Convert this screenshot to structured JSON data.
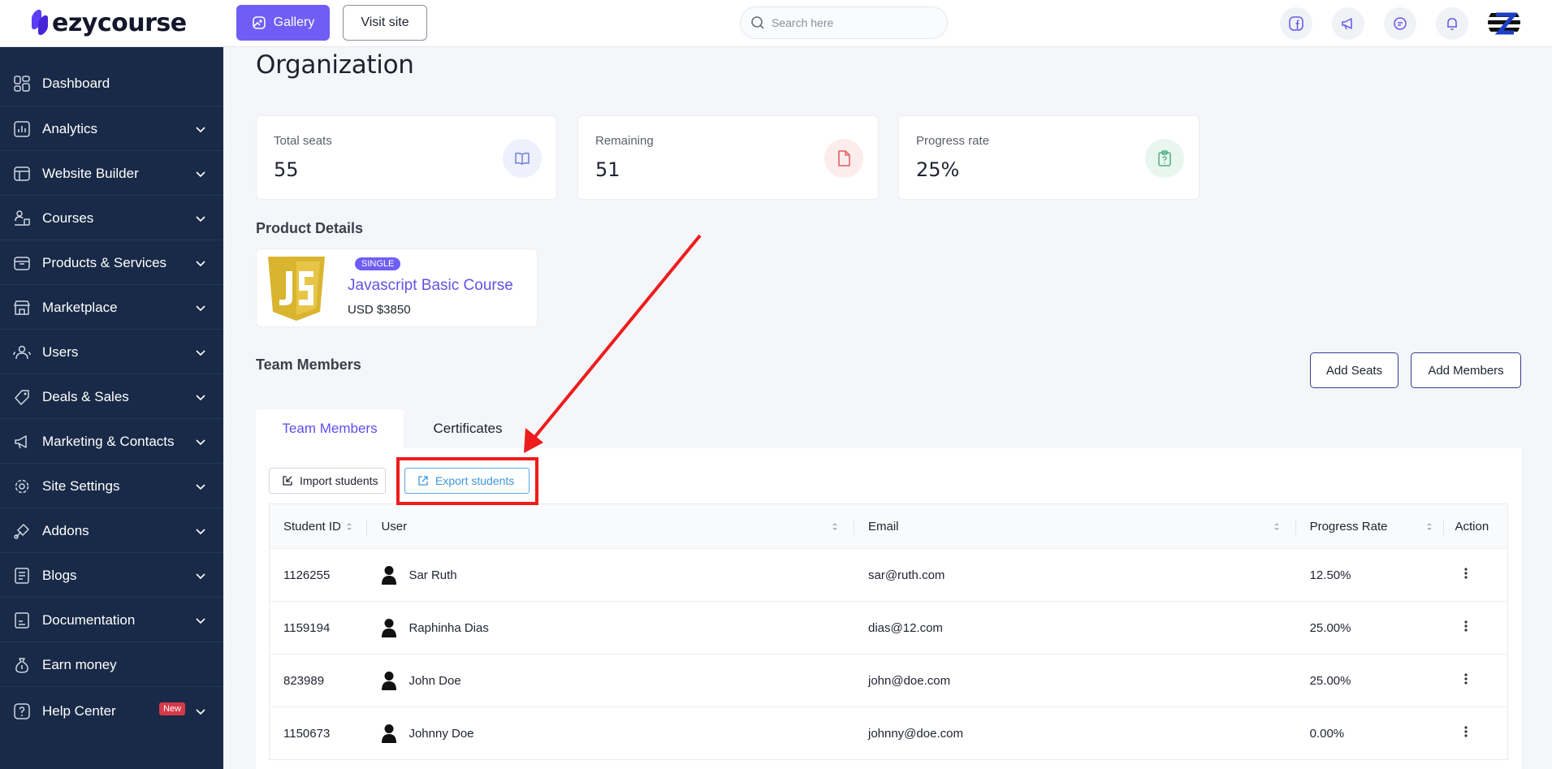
{
  "brand": {
    "logo_text": "ezycourse"
  },
  "header": {
    "gallery_label": "Gallery",
    "visit_site_label": "Visit site",
    "search_placeholder": "Search here"
  },
  "sidebar": {
    "items": [
      {
        "label": "Dashboard",
        "icon": "dashboard-icon",
        "chevron": false
      },
      {
        "label": "Analytics",
        "icon": "analytics-icon",
        "chevron": true
      },
      {
        "label": "Website Builder",
        "icon": "website-builder-icon",
        "chevron": true
      },
      {
        "label": "Courses",
        "icon": "courses-icon",
        "chevron": true
      },
      {
        "label": "Products & Services",
        "icon": "products-icon",
        "chevron": true
      },
      {
        "label": "Marketplace",
        "icon": "marketplace-icon",
        "chevron": true
      },
      {
        "label": "Users",
        "icon": "users-icon",
        "chevron": true
      },
      {
        "label": "Deals & Sales",
        "icon": "deals-icon",
        "chevron": true
      },
      {
        "label": "Marketing & Contacts",
        "icon": "megaphone-icon",
        "chevron": true
      },
      {
        "label": "Site Settings",
        "icon": "gear-icon",
        "chevron": true
      },
      {
        "label": "Addons",
        "icon": "addons-icon",
        "chevron": true
      },
      {
        "label": "Blogs",
        "icon": "blogs-icon",
        "chevron": true
      },
      {
        "label": "Documentation",
        "icon": "documentation-icon",
        "chevron": true
      },
      {
        "label": "Earn money",
        "icon": "money-bag-icon",
        "chevron": false
      },
      {
        "label": "Help Center",
        "icon": "help-icon",
        "chevron": true,
        "badge": "New"
      }
    ]
  },
  "page": {
    "title": "Organization"
  },
  "stats": [
    {
      "label": "Total seats",
      "value": "55",
      "icon": "book-icon",
      "bg": "#eef0fb",
      "color": "#6d7fd9"
    },
    {
      "label": "Remaining",
      "value": "51",
      "icon": "file-icon",
      "bg": "#fcecec",
      "color": "#e05b5b"
    },
    {
      "label": "Progress rate",
      "value": "25%",
      "icon": "clipboard-question-icon",
      "bg": "#e8f6ef",
      "color": "#4caf84"
    }
  ],
  "product": {
    "section_title": "Product Details",
    "badge": "SINGLE",
    "name": "Javascript Basic Course",
    "price": "USD $3850"
  },
  "team": {
    "section_title": "Team Members",
    "add_seats_label": "Add Seats",
    "add_members_label": "Add Members",
    "tabs": [
      "Team Members",
      "Certificates"
    ],
    "import_label": "Import students",
    "export_label": "Export students"
  },
  "table": {
    "columns": [
      "Student ID",
      "User",
      "Email",
      "Progress Rate",
      "Action"
    ],
    "rows": [
      {
        "id": "1126255",
        "user": "Sar Ruth",
        "email": "sar@ruth.com",
        "progress": "12.50%"
      },
      {
        "id": "1159194",
        "user": "Raphinha Dias",
        "email": "dias@12.com",
        "progress": "25.00%"
      },
      {
        "id": "823989",
        "user": "John Doe",
        "email": "john@doe.com",
        "progress": "25.00%"
      },
      {
        "id": "1150673",
        "user": "Johnny Doe",
        "email": "johnny@doe.com",
        "progress": "0.00%"
      }
    ]
  },
  "colors": {
    "accent": "#6f5ef5",
    "sidebar_bg": "#182a47",
    "annotation": "#ee1c1c"
  }
}
